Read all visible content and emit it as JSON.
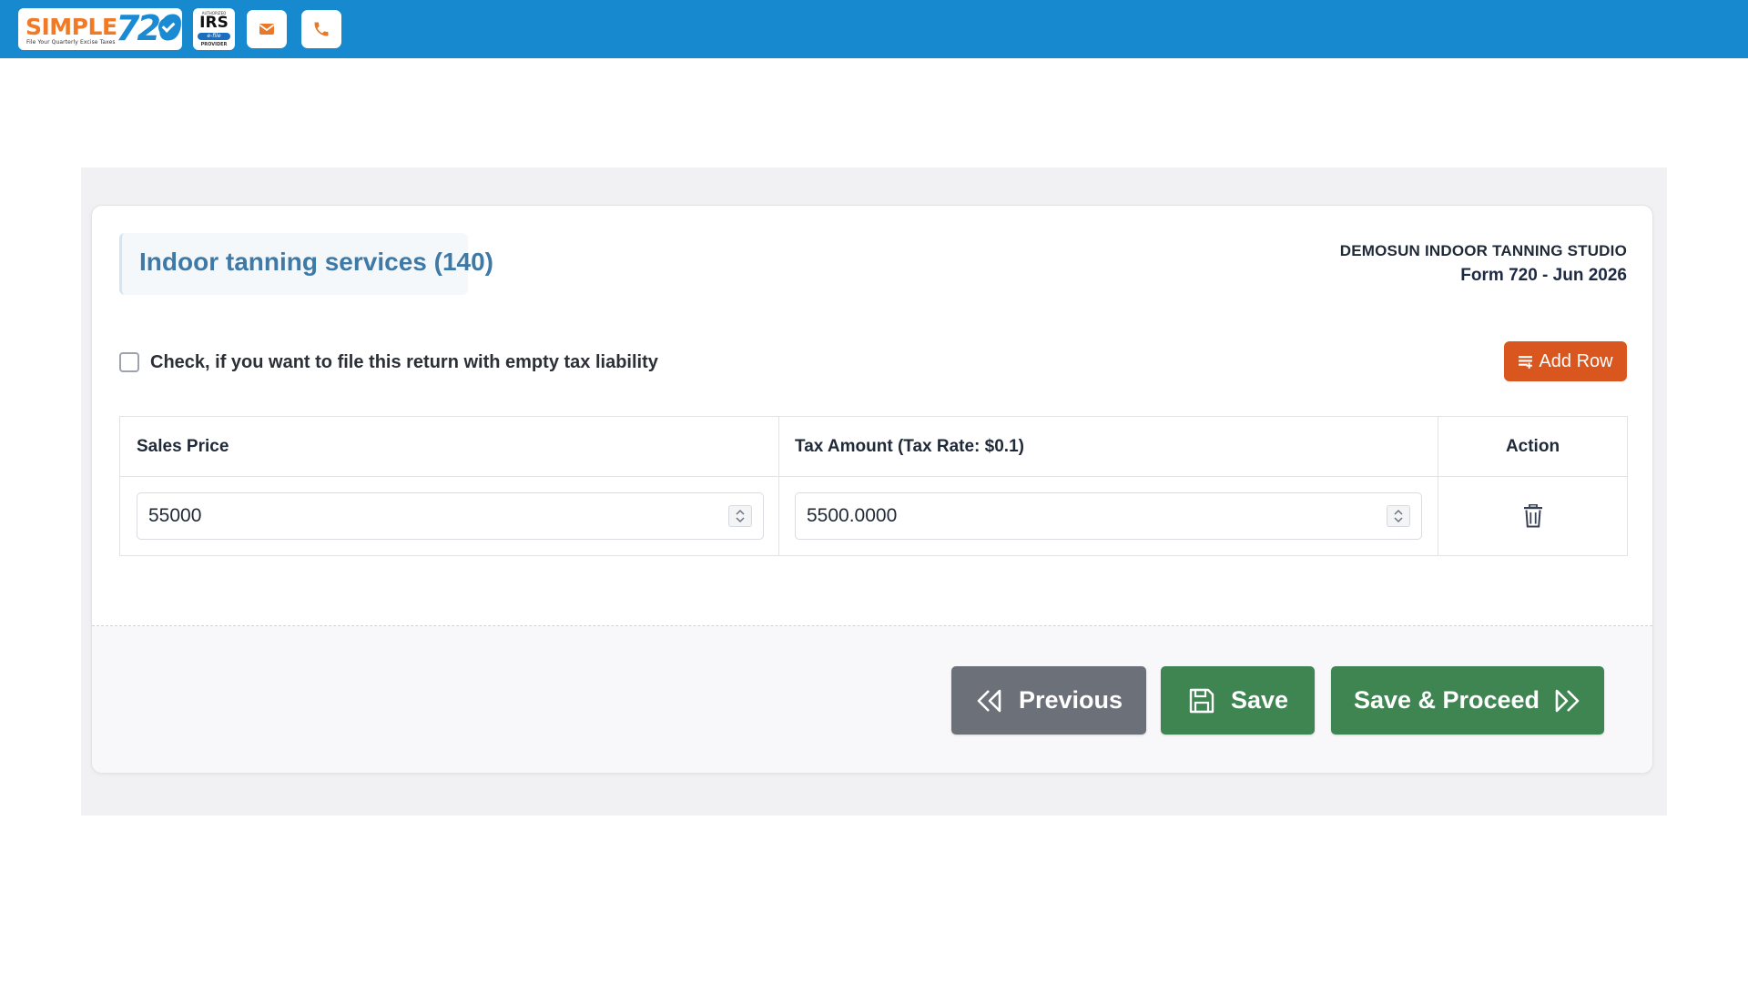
{
  "header": {
    "logo": {
      "word": "SIMPLE",
      "number": "720",
      "tagline": "File Your Quarterly Excise Taxes"
    },
    "irs_badge": {
      "top": "AUTHORIZED",
      "main": "IRS",
      "band": "e-file",
      "bottom": "PROVIDER"
    },
    "icons": {
      "mail": "envelope-icon",
      "phone": "phone-icon"
    }
  },
  "page": {
    "title": "Indoor tanning services (140)",
    "company": "DEMOSUN INDOOR TANNING STUDIO",
    "form_period": "Form 720 - Jun 2026",
    "empty_liability_label": "Check, if you want to file this return with empty tax liability",
    "empty_liability_checked": false,
    "add_row_label": "Add Row"
  },
  "table": {
    "headers": [
      "Sales Price",
      "Tax Amount (Tax Rate: $0.1)",
      "Action"
    ],
    "rows": [
      {
        "sales_price": "55000",
        "tax_amount": "5500.0000"
      }
    ]
  },
  "actions": {
    "previous": "Previous",
    "save": "Save",
    "save_proceed": "Save & Proceed"
  },
  "colors": {
    "topbar": "#1689cf",
    "title": "#3f79a6",
    "add_row": "#d9561e",
    "previous": "#6c7078",
    "save": "#3e8552"
  }
}
